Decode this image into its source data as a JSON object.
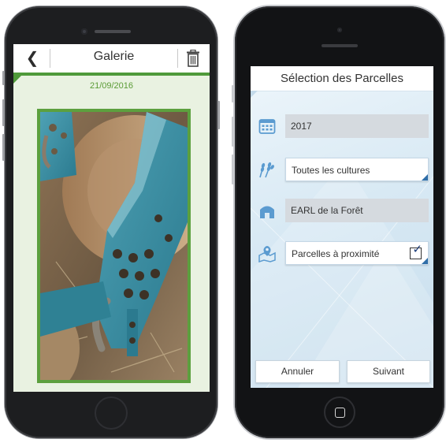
{
  "left_phone": {
    "header": {
      "back_glyph": "❮",
      "title": "Galerie"
    },
    "date": "21/09/2016",
    "photo": {
      "icon": "photo-image"
    },
    "icons": [
      "chevron-left-icon",
      "trash-icon"
    ],
    "colors": {
      "accent": "#4f9a3a",
      "background": "#e9f2e1",
      "date": "#5a9b35"
    }
  },
  "right_phone": {
    "header": {
      "title": "Sélection des Parcelles"
    },
    "fields": {
      "year": {
        "value": "2017",
        "icon": "calendar-icon"
      },
      "crops": {
        "value": "Toutes les cultures",
        "icon": "wheat-icon"
      },
      "farm": {
        "value": "EARL de la Forêt",
        "icon": "farm-house-icon"
      },
      "nearby": {
        "value": "Parcelles à proximité",
        "icon": "map-pin-icon",
        "checked": true,
        "check_glyph": "✓"
      }
    },
    "buttons": {
      "cancel": "Annuler",
      "next": "Suivant"
    },
    "colors": {
      "accent": "#2f6ea8",
      "icon": "#5b9bd0",
      "field_grey": "#d5dadf"
    }
  }
}
